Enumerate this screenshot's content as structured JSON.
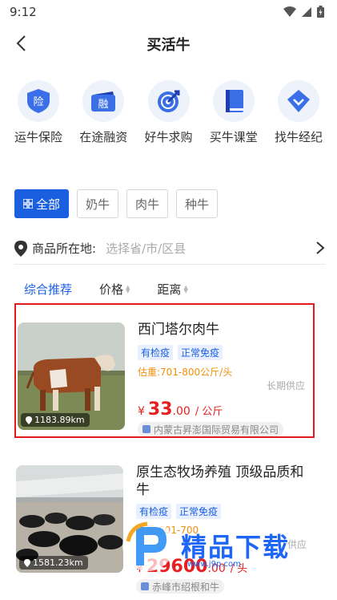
{
  "status": {
    "time": "9:12"
  },
  "header": {
    "title": "买活牛"
  },
  "services": [
    {
      "label": "运牛保险",
      "glyph": "险",
      "icon": "shield-icon"
    },
    {
      "label": "在途融资",
      "glyph": "融",
      "icon": "card-icon"
    },
    {
      "label": "好牛求购",
      "glyph": "",
      "icon": "target-icon"
    },
    {
      "label": "买牛课堂",
      "glyph": "",
      "icon": "book-icon"
    },
    {
      "label": "找牛经纪",
      "glyph": "",
      "icon": "diamond-icon"
    }
  ],
  "filters": [
    {
      "label": "全部",
      "active": true
    },
    {
      "label": "奶牛",
      "active": false
    },
    {
      "label": "肉牛",
      "active": false
    },
    {
      "label": "种牛",
      "active": false
    }
  ],
  "location": {
    "label": "商品所在地:",
    "placeholder": "选择省/市/区县"
  },
  "sort": [
    {
      "label": "综合推荐",
      "active": true
    },
    {
      "label": "价格",
      "active": false
    },
    {
      "label": "距离",
      "active": false
    }
  ],
  "products": [
    {
      "title": "西门塔尔肉牛",
      "tags": [
        "有检疫",
        "正常免疫"
      ],
      "weight": "估重:701-800公斤/头",
      "supply": "长期供应",
      "currency": "¥",
      "price_int": "33",
      "price_dec": ".00",
      "unit": "/ 公斤",
      "company": "内蒙古昇澎国际贸易有限公司",
      "distance": "1183.89km"
    },
    {
      "title": "原生态牧场养殖 顶级品质和牛",
      "tags": [
        "有检疫",
        "正常免疫"
      ],
      "weight": "估重:601-700",
      "supply": "供应",
      "currency": "¥",
      "price_int": "29600",
      "price_dec": ".00",
      "unit": "/ 头",
      "company": "赤峰市绍根和牛",
      "distance": "1581.23km"
    }
  ],
  "watermark": {
    "text": "精品下载",
    "url": "www.j9p.com"
  },
  "colors": {
    "accent": "#1a5fe0",
    "price": "#e61f1f",
    "weight": "#f0900a",
    "highlight": "#e11b1b"
  }
}
